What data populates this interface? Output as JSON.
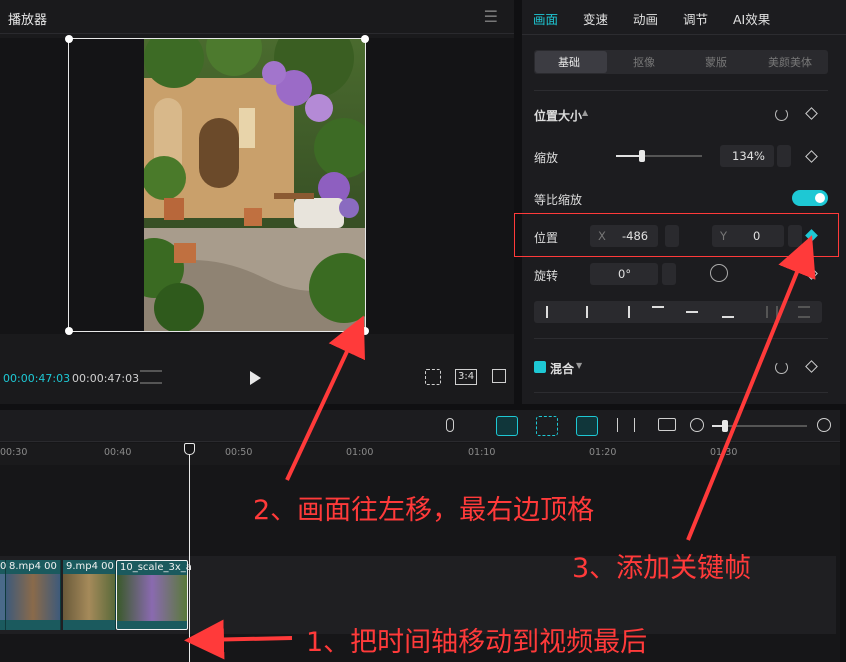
{
  "player": {
    "title": "播放器",
    "current_time": "00:00:47:03",
    "total_time": "00:00:47:03",
    "aspect_label": "3:4"
  },
  "inspector": {
    "tabs": [
      "画面",
      "变速",
      "动画",
      "调节",
      "AI效果"
    ],
    "active_tab": "画面",
    "sub_tabs": [
      "基础",
      "抠像",
      "蒙版",
      "美颜美体"
    ],
    "active_sub_tab": "基础",
    "section_title": "位置大小",
    "scale_label": "缩放",
    "scale_value": "134%",
    "scale_fraction": 0.3,
    "uniform_scale_label": "等比缩放",
    "uniform_scale_on": true,
    "position_label": "位置",
    "x_label": "X",
    "x_value": "-486",
    "y_label": "Y",
    "y_value": "0",
    "rotation_label": "旋转",
    "rotation_value": "0°",
    "blend_label": "混合",
    "accent_color": "#1ec8d4"
  },
  "timeline": {
    "ruler_ticks": [
      "00:30",
      "00:40",
      "00:50",
      "01:00",
      "01:10",
      "01:20",
      "01:30"
    ],
    "clips": [
      {
        "label": "0"
      },
      {
        "label": "8.mp4  00"
      },
      {
        "label": "9.mp4  00"
      },
      {
        "label": "10_scale_3x_a"
      }
    ]
  },
  "annotations": {
    "step1": "1、把时间轴移动到视频最后",
    "step2": "2、画面往左移，最右边顶格",
    "step3": "3、添加关键帧",
    "color": "#ff3a3a"
  }
}
